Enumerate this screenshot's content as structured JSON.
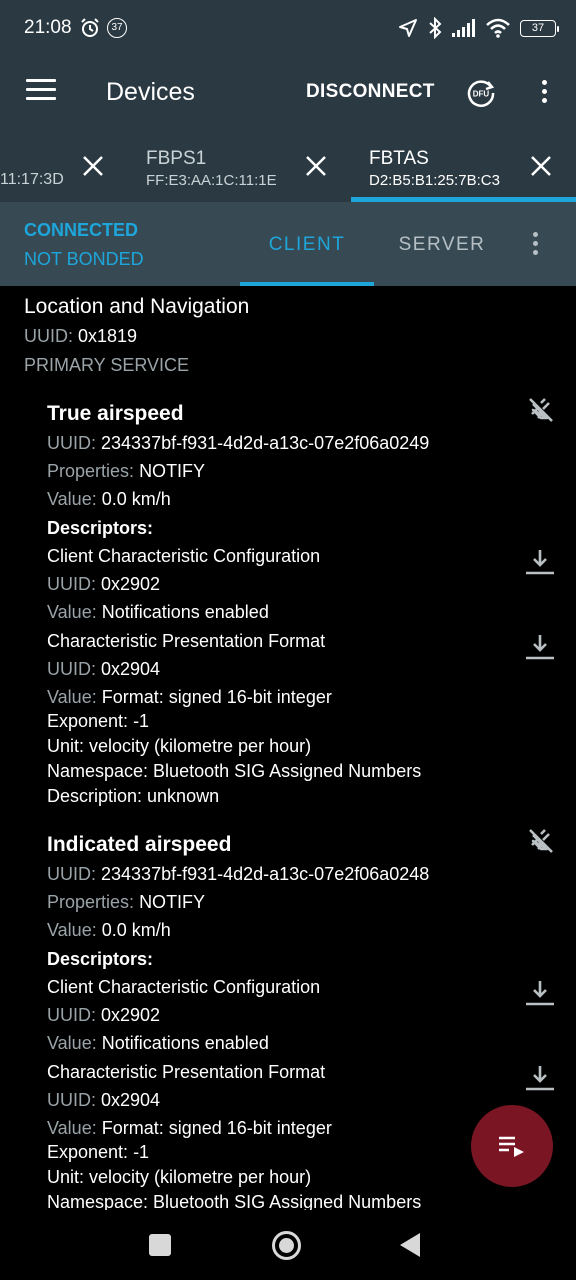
{
  "status_bar": {
    "time": "21:08",
    "notification_count": "37",
    "battery": "37"
  },
  "toolbar": {
    "title": "Devices",
    "disconnect_label": "DISCONNECT",
    "dfu_label": "DFU"
  },
  "device_tabs": [
    {
      "name": "",
      "address": "11:17:3D",
      "active": false
    },
    {
      "name": "FBPS1",
      "address": "FF:E3:AA:1C:11:1E",
      "active": false
    },
    {
      "name": "FBTAS",
      "address": "D2:B5:B1:25:7B:C3",
      "active": true
    }
  ],
  "connection": {
    "status": "CONNECTED",
    "bond": "NOT BONDED",
    "tabs": [
      "CLIENT",
      "SERVER"
    ],
    "selected_tab": "CLIENT"
  },
  "service": {
    "name": "Location and Navigation",
    "uuid_label": "UUID:",
    "uuid": "0x1819",
    "type": "PRIMARY SERVICE"
  },
  "characteristics": [
    {
      "name": "True airspeed",
      "uuid_label": "UUID:",
      "uuid": "234337bf-f931-4d2d-a13c-07e2f06a0249",
      "properties_label": "Properties:",
      "properties": "NOTIFY",
      "value_label": "Value:",
      "value": "0.0 km/h",
      "descriptors_label": "Descriptors:",
      "descriptors": [
        {
          "name": "Client Characteristic Configuration",
          "uuid_label": "UUID:",
          "uuid": "0x2902",
          "value_label": "Value:",
          "value": "Notifications enabled",
          "extra": []
        },
        {
          "name": "Characteristic Presentation Format",
          "uuid_label": "UUID:",
          "uuid": "0x2904",
          "value_label": "Value:",
          "value": "Format: signed 16-bit integer",
          "extra": [
            "Exponent: -1",
            "Unit: velocity (kilometre per hour)",
            "Namespace: Bluetooth SIG Assigned Numbers",
            "Description: unknown"
          ]
        }
      ]
    },
    {
      "name": "Indicated airspeed",
      "uuid_label": "UUID:",
      "uuid": "234337bf-f931-4d2d-a13c-07e2f06a0248",
      "properties_label": "Properties:",
      "properties": "NOTIFY",
      "value_label": "Value:",
      "value": "0.0 km/h",
      "descriptors_label": "Descriptors:",
      "descriptors": [
        {
          "name": "Client Characteristic Configuration",
          "uuid_label": "UUID:",
          "uuid": "0x2902",
          "value_label": "Value:",
          "value": "Notifications enabled",
          "extra": []
        },
        {
          "name": "Characteristic Presentation Format",
          "uuid_label": "UUID:",
          "uuid": "0x2904",
          "value_label": "Value:",
          "value": "Format: signed 16-bit integer",
          "extra": [
            "Exponent: -1",
            "Unit: velocity (kilometre per hour)",
            "Namespace: Bluetooth SIG Assigned Numbers"
          ]
        }
      ]
    }
  ],
  "colors": {
    "appbar": "#2b3a42",
    "connection_bar": "#374a54",
    "accent": "#1ea6db",
    "fab": "#7a1523",
    "secondary_text": "#9aa3a8"
  },
  "icons": {
    "notify": "notifications-off-icon",
    "read_descriptor": "download-icon",
    "fab": "playlist-log-icon"
  }
}
